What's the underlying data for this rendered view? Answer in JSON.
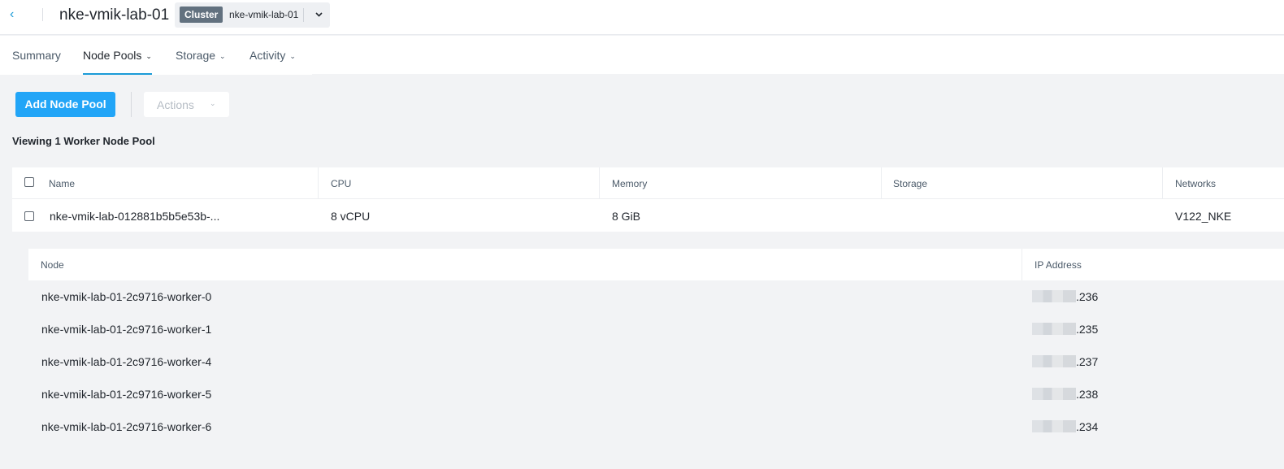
{
  "header": {
    "back_glyph": "‹",
    "title": "nke-vmik-lab-01",
    "cluster_tag": "Cluster",
    "cluster_name": "nke-vmik-lab-01",
    "caret_icon": "chevron-down-icon"
  },
  "tabs": [
    {
      "label": "Summary",
      "dropdown": false,
      "active": false
    },
    {
      "label": "Node Pools",
      "dropdown": true,
      "active": true
    },
    {
      "label": "Storage",
      "dropdown": true,
      "active": false
    },
    {
      "label": "Activity",
      "dropdown": true,
      "active": false
    }
  ],
  "toolbar": {
    "add_label": "Add Node Pool",
    "actions_label": "Actions"
  },
  "viewing_text": "Viewing 1 Worker Node Pool",
  "pool_table": {
    "columns": [
      "Name",
      "CPU",
      "Memory",
      "Storage",
      "Networks"
    ],
    "rows": [
      {
        "name": "nke-vmik-lab-012881b5b5e53b-...",
        "cpu": "8 vCPU",
        "memory": "8 GiB",
        "storage": "",
        "networks": "V122_NKE"
      }
    ]
  },
  "node_table": {
    "columns": [
      "Node",
      "IP Address"
    ],
    "rows": [
      {
        "node": "nke-vmik-lab-01-2c9716-worker-0",
        "ip_suffix": ".236"
      },
      {
        "node": "nke-vmik-lab-01-2c9716-worker-1",
        "ip_suffix": ".235"
      },
      {
        "node": "nke-vmik-lab-01-2c9716-worker-4",
        "ip_suffix": ".237"
      },
      {
        "node": "nke-vmik-lab-01-2c9716-worker-5",
        "ip_suffix": ".238"
      },
      {
        "node": "nke-vmik-lab-01-2c9716-worker-6",
        "ip_suffix": ".234"
      }
    ]
  },
  "colors": {
    "accent": "#1b9bd7",
    "primary_button": "#22a5f7",
    "cluster_tag_bg": "#62717f",
    "page_bg": "#f2f3f5"
  }
}
